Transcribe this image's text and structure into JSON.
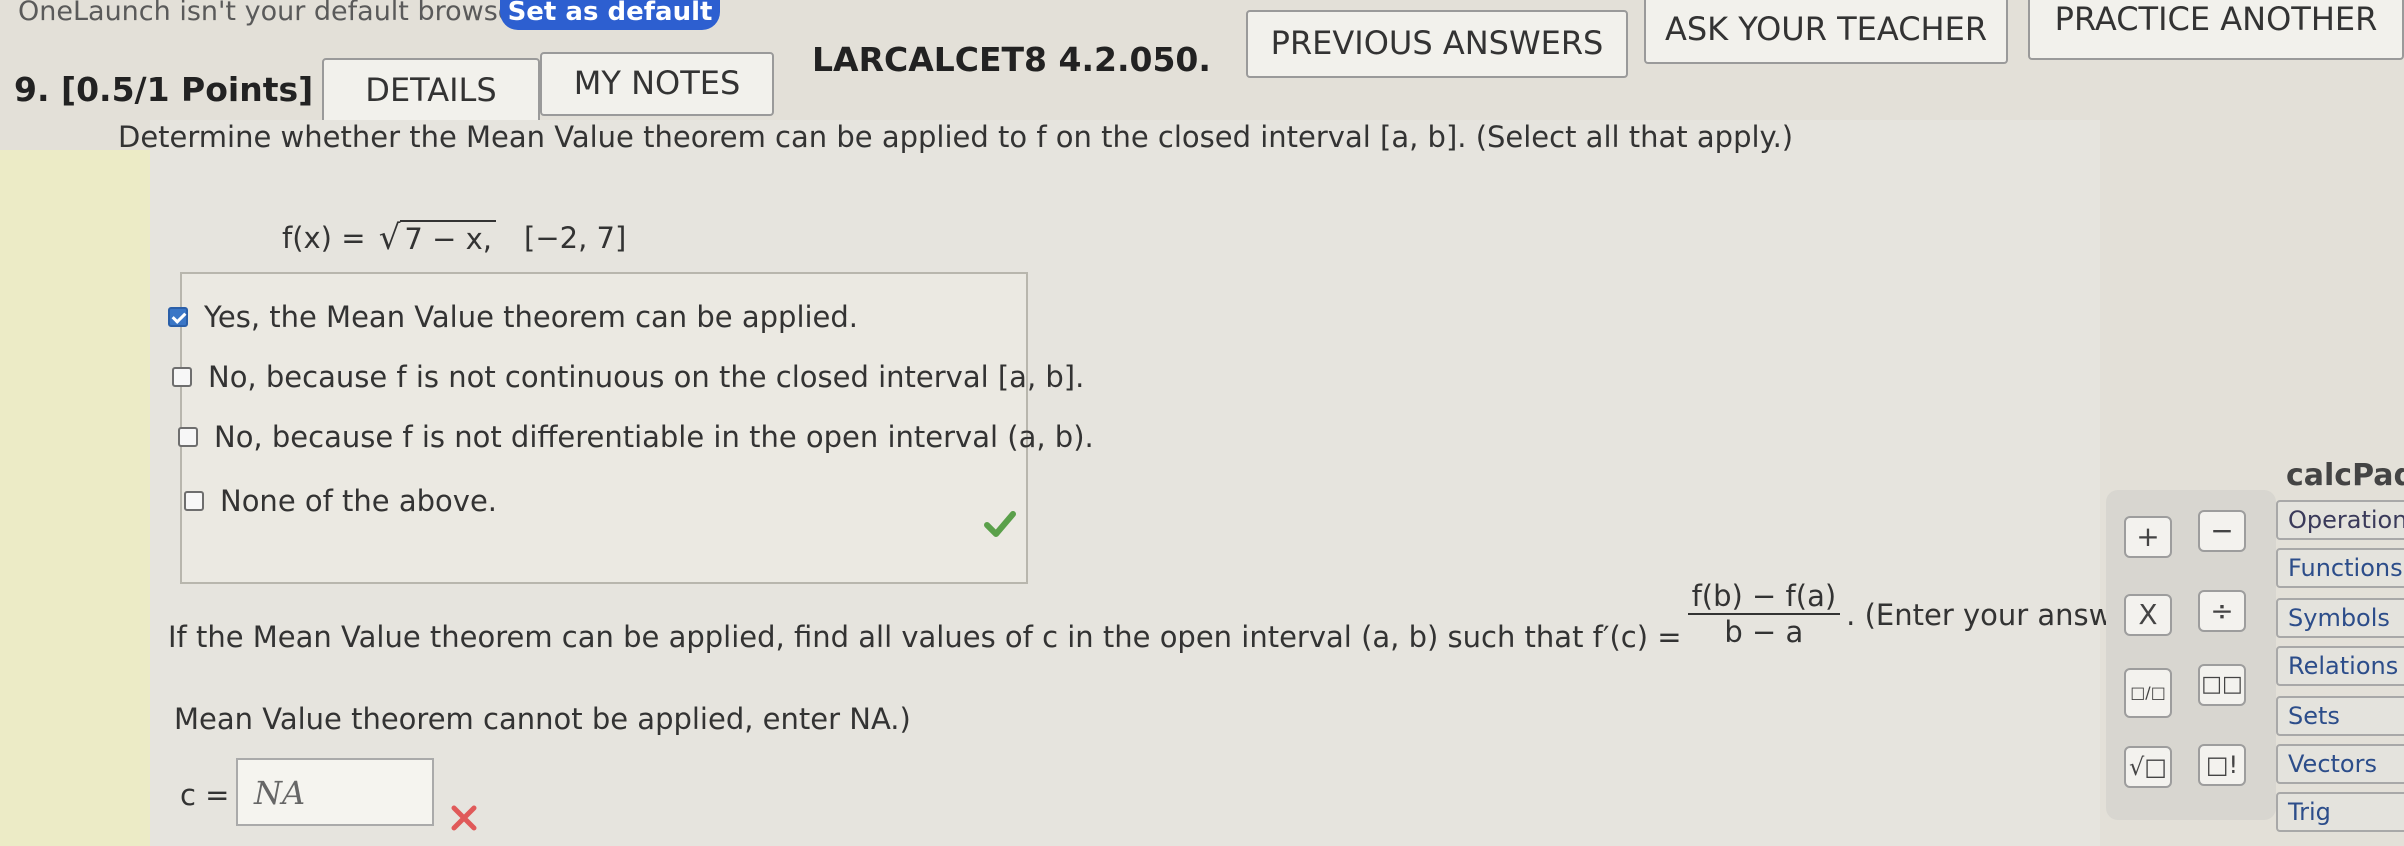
{
  "browser_notice": {
    "text": "OneLaunch isn't your default browser",
    "set_default_label": "Set as default"
  },
  "question": {
    "number_points": "9.  [0.5/1 Points]",
    "tabs": {
      "details": "DETAILS",
      "my_notes": "MY NOTES"
    },
    "code": "LARCALCET8 4.2.050.",
    "actions": {
      "previous_answers": "PREVIOUS ANSWERS",
      "ask_teacher": "ASK YOUR TEACHER",
      "practice_another": "PRACTICE ANOTHER"
    }
  },
  "prompt": "Determine whether the Mean Value theorem can be applied to f on the closed interval [a, b]. (Select all that apply.)",
  "function": {
    "lhs": "f(x) = ",
    "radicand": "7 − x,",
    "interval": "[−2, 7]"
  },
  "options": [
    {
      "label": "Yes, the Mean Value theorem can be applied.",
      "checked": true
    },
    {
      "label": "No, because f is not continuous on the closed interval [a, b].",
      "checked": false
    },
    {
      "label": "No, because f is not differentiable in the open interval (a, b).",
      "checked": false
    },
    {
      "label": "None of the above.",
      "checked": false
    }
  ],
  "part2": {
    "text_before": "If the Mean Value theorem can be applied, find all values of c in the open interval (a, b) such that f′(c) =",
    "fraction_num": "f(b) − f(a)",
    "fraction_den": "b − a",
    "text_after": ". (Enter your answers as a comma-s",
    "line2": "Mean Value theorem cannot be applied, enter NA.)",
    "input_label": "c =",
    "input_value": "NA"
  },
  "status": {
    "correct_color": "#5aa04a",
    "wrong_color": "#e05a5a",
    "accent": "#3a76c6"
  },
  "calcpad": {
    "title": "calcPad",
    "keys": [
      "+",
      "−",
      "X",
      "÷",
      "□/□",
      "□□",
      "√□",
      "□!"
    ],
    "menu": [
      "Operations",
      "Functions",
      "Symbols",
      "Relations",
      "Sets",
      "Vectors",
      "Trig"
    ]
  }
}
